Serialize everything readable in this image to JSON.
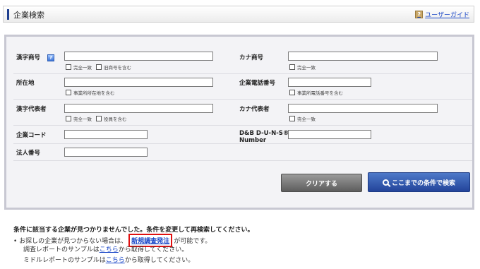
{
  "header": {
    "title": "企業検索",
    "guide_link": "ユーザーガイド",
    "guide_icon": "?"
  },
  "form": {
    "kanji_name_label": "漢字商号",
    "kanji_name_value": "",
    "help_icon": "?",
    "kanji_exact_label": "完全一致",
    "kanji_former_label": "旧商号を含む",
    "kana_name_label": "カナ商号",
    "kana_name_value": "",
    "kana_exact_label": "完全一致",
    "address_label": "所在地",
    "address_value": "",
    "address_office_label": "事業所所在地を含む",
    "phone_label": "企業電話番号",
    "phone_value": "",
    "phone_office_label": "事業所電話番号を含む",
    "kanji_rep_label": "漢字代表者",
    "kanji_rep_value": "",
    "kanji_rep_exact_label": "完全一致",
    "kanji_rep_officer_label": "役員を含む",
    "kana_rep_label": "カナ代表者",
    "kana_rep_value": "",
    "kana_rep_exact_label": "完全一致",
    "company_code_label": "企業コード",
    "company_code_value": "",
    "duns_label_1": "D&B D-U-N-S®",
    "duns_label_2": "Number",
    "duns_value": "",
    "corp_number_label": "法人番号",
    "corp_number_value": "",
    "clear_button": "クリアする",
    "search_button": "ここまでの条件で検索"
  },
  "result": {
    "message": "条件に該当する企業が見つかりませんでした。条件を変更して再検索してください。",
    "line1_prefix": "• お探しの企業が見つからない場合は、",
    "line1_link": "新規調査発注",
    "line1_suffix": "が可能です。",
    "line2_prefix": "調査レポートのサンプルは",
    "line2_link": "こちら",
    "line2_suffix": "から取得してください。",
    "line3_prefix": "ミドルレポートのサンプルは",
    "line3_link": "こちら",
    "line3_suffix": "から取得してください。"
  }
}
